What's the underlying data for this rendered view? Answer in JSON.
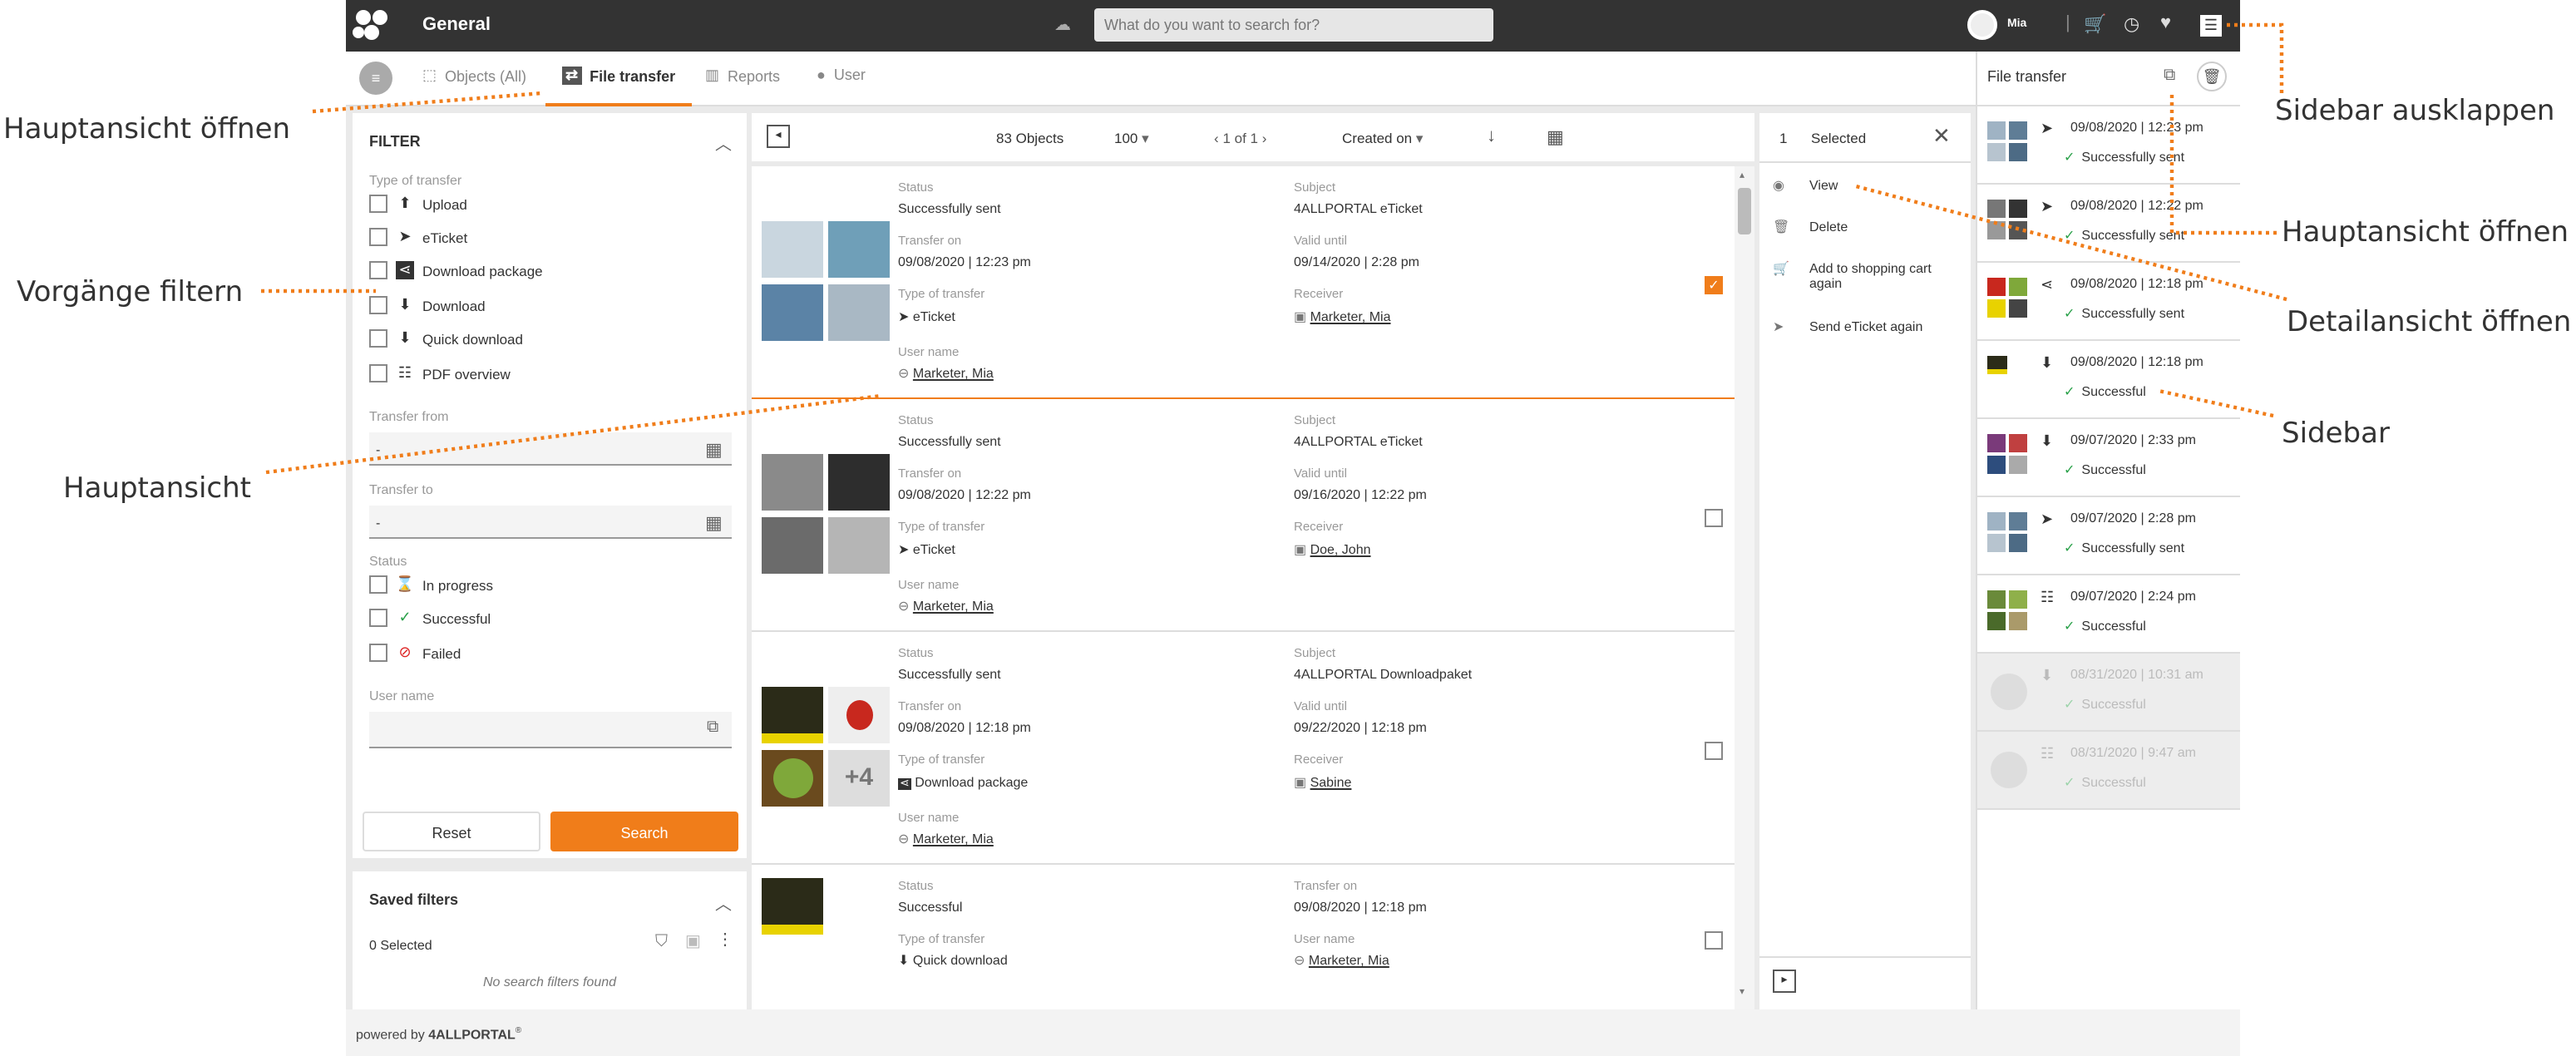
{
  "header": {
    "title": "General",
    "search_placeholder": "What do you want to search for?",
    "user": "Mia"
  },
  "tabs": [
    {
      "label": "Objects (All)"
    },
    {
      "label": "File transfer"
    },
    {
      "label": "Reports"
    },
    {
      "label": "User"
    }
  ],
  "filter": {
    "title": "FILTER",
    "type_label": "Type of transfer",
    "types": [
      "Upload",
      "eTicket",
      "Download package",
      "Download",
      "Quick download",
      "PDF overview"
    ],
    "transfer_from_label": "Transfer from",
    "transfer_from_value": "-",
    "transfer_to_label": "Transfer to",
    "transfer_to_value": "-",
    "status_label": "Status",
    "statuses": [
      "In progress",
      "Successful",
      "Failed"
    ],
    "username_label": "User name",
    "reset": "Reset",
    "search": "Search"
  },
  "saved_filters": {
    "title": "Saved filters",
    "selected": "0 Selected",
    "empty": "No search filters found"
  },
  "toolbar": {
    "objects": "83 Objects",
    "per_page": "100",
    "pagination": "1 of 1",
    "sort": "Created on"
  },
  "rows": [
    {
      "c1": [
        [
          "Status",
          "Successfully sent"
        ],
        [
          "Transfer on",
          "09/08/2020 | 12:23 pm"
        ],
        [
          "Type of transfer",
          "eTicket"
        ],
        [
          "User name",
          "Marketer, Mia"
        ]
      ],
      "c2": [
        [
          "Subject",
          "4ALLPORTAL eTicket"
        ],
        [
          "Valid until",
          "09/14/2020 | 2:28 pm"
        ],
        [
          "Receiver",
          "Marketer, Mia"
        ]
      ]
    },
    {
      "c1": [
        [
          "Status",
          "Successfully sent"
        ],
        [
          "Transfer on",
          "09/08/2020 | 12:22 pm"
        ],
        [
          "Type of transfer",
          "eTicket"
        ],
        [
          "User name",
          "Marketer, Mia"
        ]
      ],
      "c2": [
        [
          "Subject",
          "4ALLPORTAL eTicket"
        ],
        [
          "Valid until",
          "09/16/2020 | 12:22 pm"
        ],
        [
          "Receiver",
          "Doe, John"
        ]
      ]
    },
    {
      "c1": [
        [
          "Status",
          "Successfully sent"
        ],
        [
          "Transfer on",
          "09/08/2020 | 12:18 pm"
        ],
        [
          "Type of transfer",
          "Download package"
        ],
        [
          "User name",
          "Marketer, Mia"
        ]
      ],
      "c2": [
        [
          "Subject",
          "4ALLPORTAL Downloadpaket"
        ],
        [
          "Valid until",
          "09/22/2020 | 12:18 pm"
        ],
        [
          "Receiver",
          "Sabine"
        ]
      ],
      "more": "+4"
    },
    {
      "c1": [
        [
          "Status",
          "Successful"
        ],
        [
          "Type of transfer",
          "Quick download"
        ]
      ],
      "c2": [
        [
          "Transfer on",
          "09/08/2020 | 12:18 pm"
        ],
        [
          "User name",
          "Marketer, Mia"
        ]
      ]
    }
  ],
  "actions": {
    "selected_count": "1",
    "selected_label": "Selected",
    "items": [
      "View",
      "Delete",
      "Add to shopping cart again",
      "Send eTicket again"
    ]
  },
  "sidebar": {
    "title": "File transfer",
    "items": [
      {
        "date": "09/08/2020 | 12:23 pm",
        "status": "Successfully sent"
      },
      {
        "date": "09/08/2020 | 12:22 pm",
        "status": "Successfully sent"
      },
      {
        "date": "09/08/2020 | 12:18 pm",
        "status": "Successfully sent"
      },
      {
        "date": "09/08/2020 | 12:18 pm",
        "status": "Successful"
      },
      {
        "date": "09/07/2020 | 2:33 pm",
        "status": "Successful"
      },
      {
        "date": "09/07/2020 | 2:28 pm",
        "status": "Successfully sent"
      },
      {
        "date": "09/07/2020 | 2:24 pm",
        "status": "Successful"
      },
      {
        "date": "08/31/2020 | 10:31 am",
        "status": "Successful"
      },
      {
        "date": "08/31/2020 | 9:47 am",
        "status": "Successful"
      }
    ]
  },
  "footer": {
    "powered": "powered by",
    "brand": "4ALLPORTAL"
  },
  "annotations": [
    "Hauptansicht öffnen",
    "Vorgänge filtern",
    "Hauptansicht",
    "Sidebar ausklappen",
    "Hauptansicht öffnen",
    "Detailansicht öffnen",
    "Sidebar"
  ],
  "colors": {
    "accent": "#f07d1a",
    "success": "#2aa14a",
    "topbar": "#333333"
  }
}
